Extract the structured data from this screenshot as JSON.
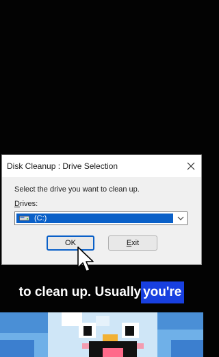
{
  "dialog": {
    "title": "Disk Cleanup : Drive Selection",
    "prompt": "Select the drive you want to clean up.",
    "drives_label_mnemonic": "D",
    "drives_label_rest": "rives:",
    "selected_drive": "(C:)",
    "ok_label": "OK",
    "exit_mnemonic": "E",
    "exit_rest": "xit"
  },
  "caption": {
    "text": "to clean up. Usually ",
    "highlight": "you're"
  },
  "colors": {
    "selection": "#0a60c8",
    "caption_highlight": "#1840e0"
  },
  "icons": [
    "close-icon",
    "drive-icon",
    "chevron-down-icon",
    "mouse-cursor-icon"
  ]
}
